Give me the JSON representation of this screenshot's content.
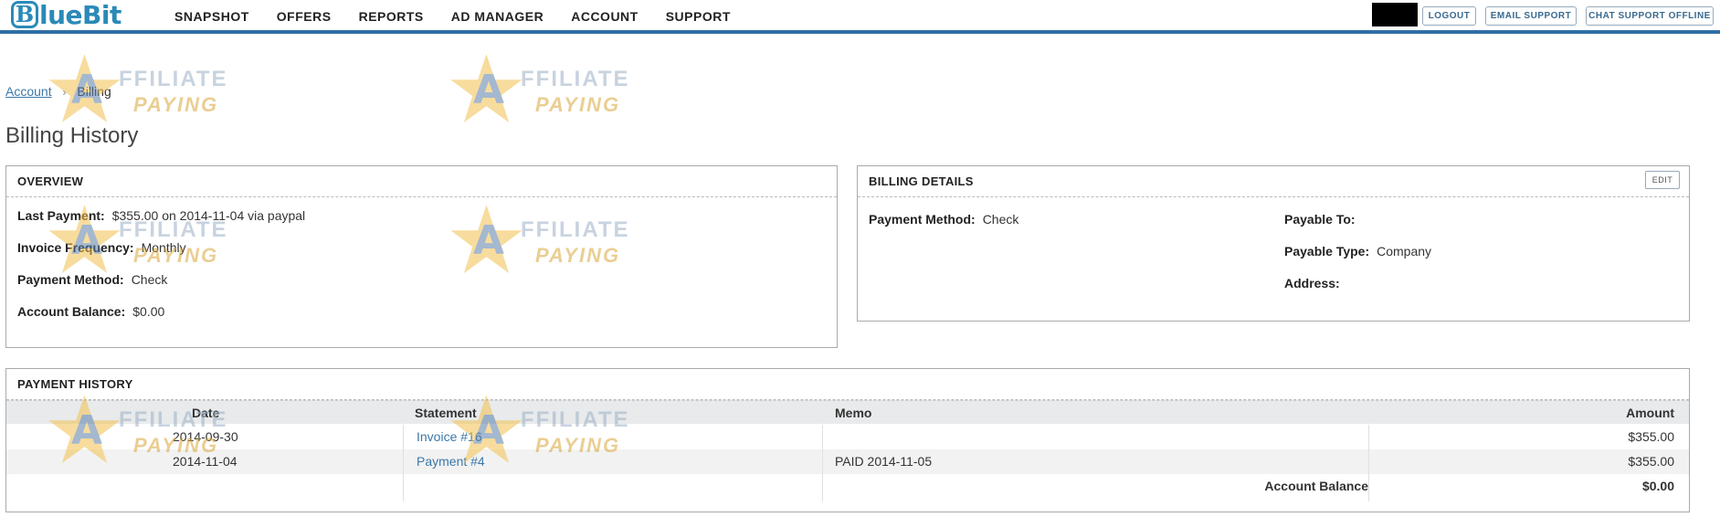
{
  "brand": {
    "logo_letter": "B",
    "logo_text": "lueBit"
  },
  "nav": [
    "SNAPSHOT",
    "OFFERS",
    "REPORTS",
    "AD MANAGER",
    "ACCOUNT",
    "SUPPORT"
  ],
  "top_buttons": {
    "logout": "LOGOUT",
    "email": "EMAIL SUPPORT",
    "chat": "CHAT SUPPORT OFFLINE"
  },
  "watermark": {
    "letter": "A",
    "line1": "FFILIATE",
    "line2": "PAYING"
  },
  "breadcrumb": {
    "parent": "Account",
    "separator": "›",
    "current": "Billing"
  },
  "page_title": "Billing History",
  "overview": {
    "title": "OVERVIEW",
    "last_payment_label": "Last Payment:",
    "last_payment_value": "$355.00 on 2014-11-04 via paypal",
    "invoice_frequency_label": "Invoice Frequency:",
    "invoice_frequency_value": "Monthly",
    "payment_method_label": "Payment Method:",
    "payment_method_value": "Check",
    "account_balance_label": "Account Balance:",
    "account_balance_value": "$0.00"
  },
  "billing_details": {
    "title": "BILLING DETAILS",
    "edit_label": "EDIT",
    "payment_method_label": "Payment Method:",
    "payment_method_value": "Check",
    "payable_to_label": "Payable To:",
    "payable_to_value": "",
    "payable_type_label": "Payable Type:",
    "payable_type_value": "Company",
    "address_label": "Address:",
    "address_value": ""
  },
  "payment_history": {
    "title": "PAYMENT HISTORY",
    "columns": {
      "date": "Date",
      "statement": "Statement",
      "memo": "Memo",
      "amount": "Amount"
    },
    "rows": [
      {
        "date": "2014-09-30",
        "statement": "Invoice #16",
        "memo": "",
        "amount": "$355.00"
      },
      {
        "date": "2014-11-04",
        "statement": "Payment #4",
        "memo": "PAID 2014-11-05",
        "amount": "$355.00"
      }
    ],
    "footer_label": "Account Balance",
    "footer_value": "$0.00"
  }
}
